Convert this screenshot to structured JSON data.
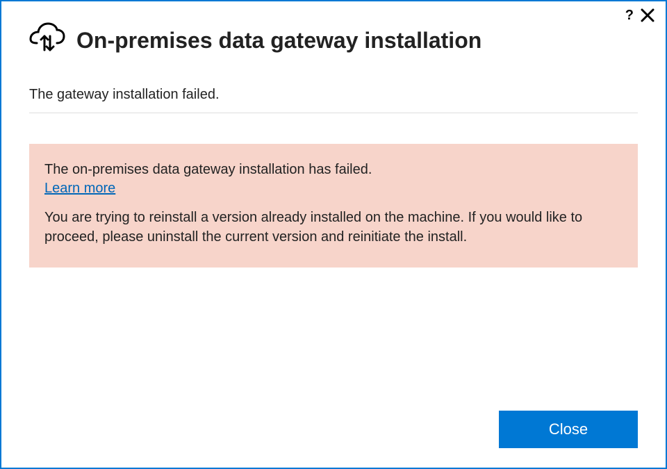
{
  "titlebar": {
    "help_label": "?"
  },
  "header": {
    "title": "On-premises data gateway installation"
  },
  "content": {
    "status_text": "The gateway installation failed.",
    "error": {
      "title": "The on-premises data gateway installation has failed.",
      "learn_more_label": "Learn more",
      "detail": "You are trying to reinstall a version already installed on the machine. If you would like to proceed, please uninstall the current version and reinitiate the install."
    }
  },
  "footer": {
    "close_label": "Close"
  }
}
